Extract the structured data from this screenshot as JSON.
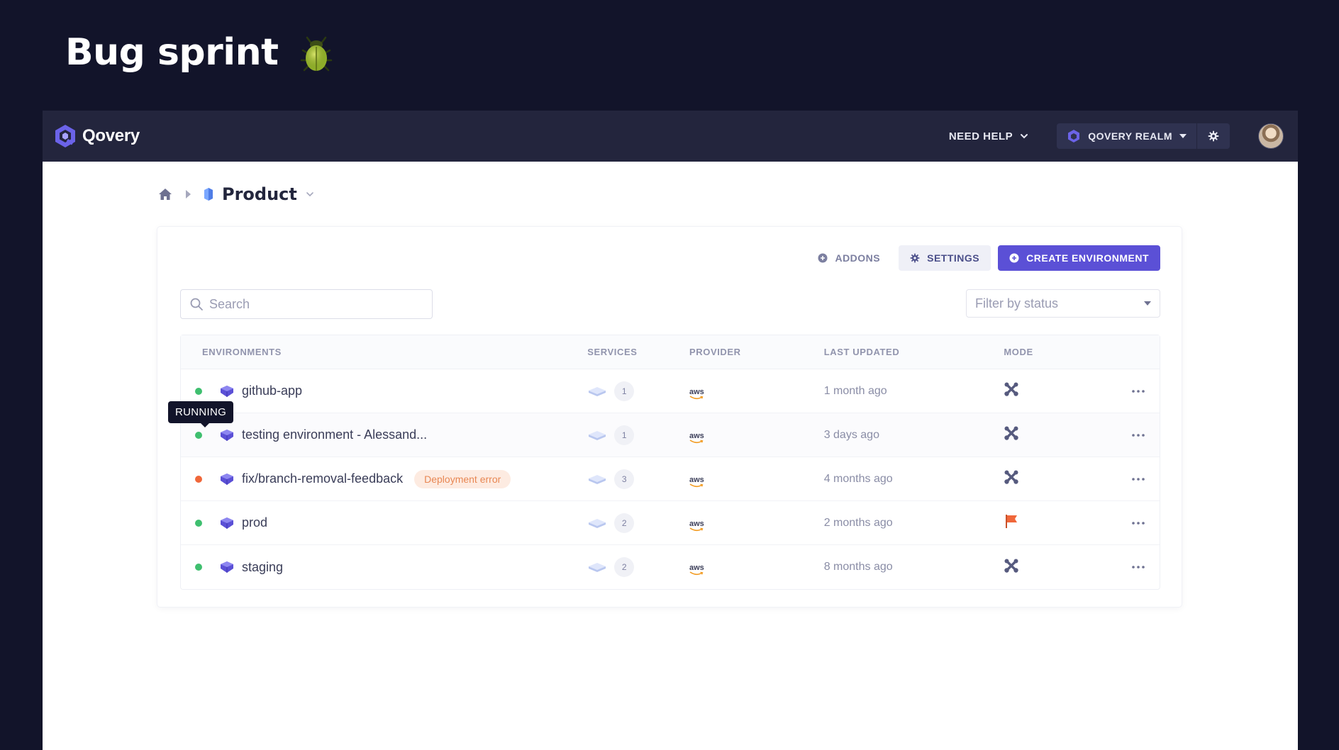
{
  "slide": {
    "title": "Bug sprint",
    "emoji_icon": "beetle-icon"
  },
  "topbar": {
    "brand": "Qovery",
    "need_help": "NEED HELP",
    "realm": "QOVERY REALM",
    "icons": [
      "qovery-logo-icon",
      "chevron-down-icon",
      "realm-icon",
      "gear-icon",
      "avatar"
    ]
  },
  "breadcrumb": {
    "title": "Product",
    "icons": [
      "home-icon",
      "project-icon",
      "chevron-down-icon"
    ]
  },
  "actions": {
    "addons": "ADDONS",
    "settings": "SETTINGS",
    "create": "CREATE ENVIRONMENT"
  },
  "search": {
    "placeholder": "Search",
    "value": ""
  },
  "filter": {
    "placeholder": "Filter by status"
  },
  "table": {
    "headers": {
      "environments": "ENVIRONMENTS",
      "services": "SERVICES",
      "provider": "PROVIDER",
      "last_updated": "LAST UPDATED",
      "mode": "MODE"
    },
    "rows": [
      {
        "name": "github-app",
        "status": "running",
        "services": "1",
        "provider": "aws",
        "updated": "1 month ago",
        "mode": "development",
        "badge": ""
      },
      {
        "name": "testing environment - Alessand...",
        "status": "running",
        "services": "1",
        "provider": "aws",
        "updated": "3 days ago",
        "mode": "development",
        "badge": ""
      },
      {
        "name": "fix/branch-removal-feedback",
        "status": "error",
        "services": "3",
        "provider": "aws",
        "updated": "4 months ago",
        "mode": "development",
        "badge": "Deployment error"
      },
      {
        "name": "prod",
        "status": "running",
        "services": "2",
        "provider": "aws",
        "updated": "2 months ago",
        "mode": "production",
        "badge": ""
      },
      {
        "name": "staging",
        "status": "running",
        "services": "2",
        "provider": "aws",
        "updated": "8 months ago",
        "mode": "development",
        "badge": ""
      }
    ]
  },
  "tooltip": {
    "text": "RUNNING"
  },
  "colors": {
    "accent": "#5b50d6",
    "running": "#3fbf6f",
    "error": "#f0673a",
    "production_flag": "#f0673a",
    "topbar": "#23253d",
    "page_bg": "#12142a"
  }
}
